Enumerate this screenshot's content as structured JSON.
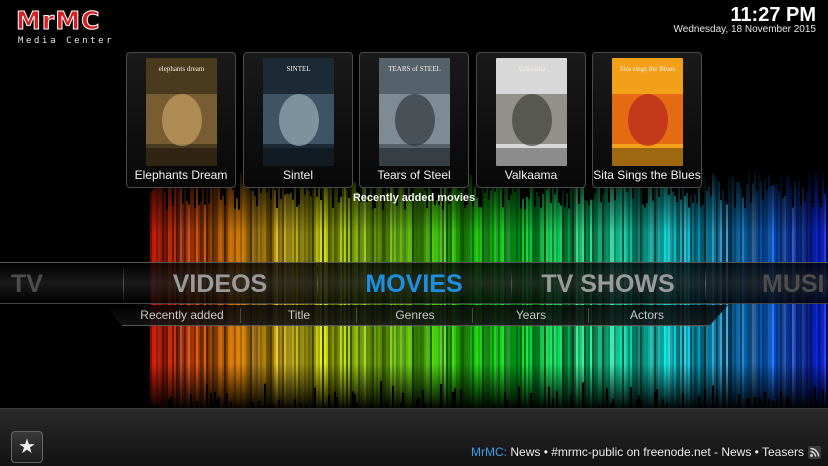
{
  "app": {
    "logo_text": "MrMC",
    "logo_subtitle": "Media Center"
  },
  "clock": {
    "time": "11:27 PM",
    "date": "Wednesday, 18 November 2015"
  },
  "recently_added": {
    "label": "Recently added movies",
    "movies": [
      {
        "title": "Elephants Dream",
        "poster_text": "elephants dream",
        "palette": [
          "#4a3a1e",
          "#8a6a3a",
          "#c9a566"
        ]
      },
      {
        "title": "Sintel",
        "poster_text": "SINTEL",
        "palette": [
          "#1c2a35",
          "#4a6273",
          "#9fb3bf"
        ]
      },
      {
        "title": "Tears of Steel",
        "poster_text": "TEARS of STEEL",
        "palette": [
          "#55626b",
          "#8c9aa3",
          "#2c3236"
        ]
      },
      {
        "title": "Valkaama",
        "poster_text": "Valkaama",
        "palette": [
          "#d8d8d8",
          "#7a7a70",
          "#3a3a34"
        ]
      },
      {
        "title": "Sita Sings the Blues",
        "poster_text": "Sita sings the Blues",
        "palette": [
          "#f2a01a",
          "#e05a10",
          "#b01e1e"
        ]
      }
    ]
  },
  "main_menu": {
    "items": [
      {
        "label": "TV",
        "state": "faded"
      },
      {
        "label": "VIDEOS",
        "state": "normal"
      },
      {
        "label": "MOVIES",
        "state": "active"
      },
      {
        "label": "TV SHOWS",
        "state": "normal"
      },
      {
        "label": "MUSI",
        "state": "faded"
      }
    ]
  },
  "submenu": {
    "items": [
      "Recently added",
      "Title",
      "Genres",
      "Years",
      "Actors"
    ]
  },
  "footer": {
    "favourites_icon": "star-icon",
    "ticker_brand": "MrMC:",
    "ticker_text": " News • #mrmc-public on freenode.net - News • Teasers",
    "rss_icon": "rss-icon"
  },
  "colors": {
    "accent": "#1e8fe0",
    "logo_red": "#d42020"
  }
}
